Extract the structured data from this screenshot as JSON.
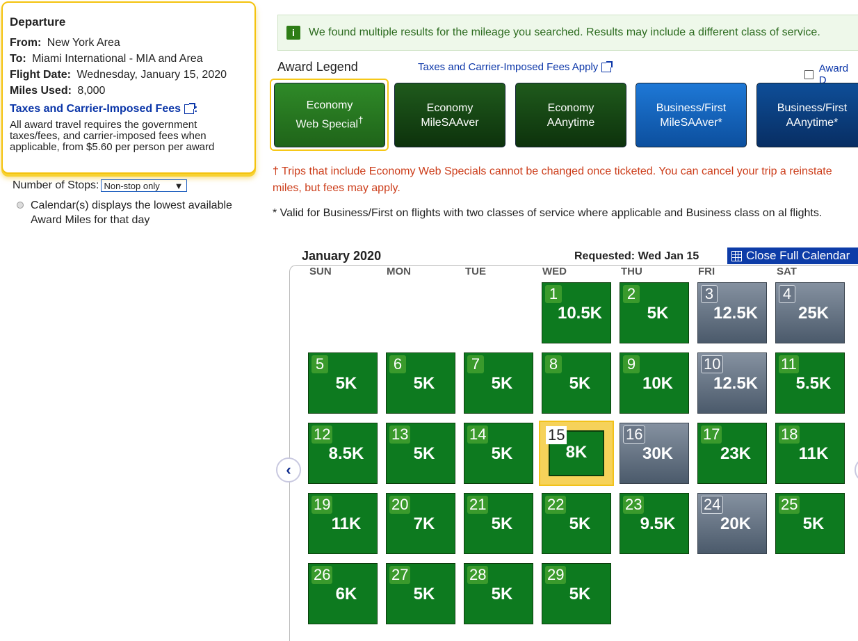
{
  "departure": {
    "title": "Departure",
    "from_label": "From:",
    "from_value": "New York Area",
    "to_label": "To:",
    "to_value": "Miami International - MIA and Area",
    "date_label": "Flight Date:",
    "date_value": "Wednesday, January 15, 2020",
    "miles_label": "Miles Used:",
    "miles_value": "8,000",
    "fees_link": "Taxes and Carrier-Imposed Fees",
    "fees_colon": ":",
    "fees_note": "All award travel requires the government taxes/fees, and carrier-imposed fees when applicable, from $5.60 per person per award"
  },
  "stops": {
    "label": "Number of Stops:",
    "selected": "Non-stop only",
    "arrow": "▼"
  },
  "calendar_note": "Calendar(s) displays the lowest available Award Miles for that day",
  "banner": {
    "icon": "i",
    "text": "We found multiple results for the mileage you searched. Results may include a different class of service."
  },
  "legend": {
    "title": "Award Legend",
    "fees_link": "Taxes and Carrier-Imposed Fees Apply",
    "award_link": "Award D",
    "tiles": [
      {
        "line1": "Economy",
        "line2": "Web Special",
        "sup": "†"
      },
      {
        "line1": "Economy",
        "line2": "MileSAAver",
        "sup": ""
      },
      {
        "line1": "Economy",
        "line2": "AAnytime",
        "sup": ""
      },
      {
        "line1": "Business/First",
        "line2": "MileSAAver*",
        "sup": ""
      },
      {
        "line1": "Business/First",
        "line2": "AAnytime*",
        "sup": ""
      }
    ]
  },
  "notes": {
    "dagger": "† Trips that include Economy Web Specials cannot be changed once ticketed. You can cancel your trip a reinstate miles, but fees may apply.",
    "star": "* Valid for Business/First on flights with two classes of service where applicable and Business class on al flights."
  },
  "calendar": {
    "month": "January 2020",
    "requested": "Requested: Wed Jan 15",
    "close_button": "Close Full Calendar",
    "weekdays": [
      "SUN",
      "MON",
      "TUE",
      "WED",
      "THU",
      "FRI",
      "SAT"
    ],
    "prev_label": "‹",
    "days": [
      {
        "day": "1",
        "miles": "10.5K",
        "type": "green"
      },
      {
        "day": "2",
        "miles": "5K",
        "type": "green"
      },
      {
        "day": "3",
        "miles": "12.5K",
        "type": "gray"
      },
      {
        "day": "4",
        "miles": "25K",
        "type": "gray"
      },
      {
        "day": "5",
        "miles": "5K",
        "type": "green"
      },
      {
        "day": "6",
        "miles": "5K",
        "type": "green"
      },
      {
        "day": "7",
        "miles": "5K",
        "type": "green"
      },
      {
        "day": "8",
        "miles": "5K",
        "type": "green"
      },
      {
        "day": "9",
        "miles": "10K",
        "type": "green"
      },
      {
        "day": "10",
        "miles": "12.5K",
        "type": "gray"
      },
      {
        "day": "11",
        "miles": "5.5K",
        "type": "green"
      },
      {
        "day": "12",
        "miles": "8.5K",
        "type": "green"
      },
      {
        "day": "13",
        "miles": "5K",
        "type": "green"
      },
      {
        "day": "14",
        "miles": "5K",
        "type": "green"
      },
      {
        "day": "15",
        "miles": "8K",
        "type": "selected"
      },
      {
        "day": "16",
        "miles": "30K",
        "type": "gray"
      },
      {
        "day": "17",
        "miles": "23K",
        "type": "green"
      },
      {
        "day": "18",
        "miles": "11K",
        "type": "green"
      },
      {
        "day": "19",
        "miles": "11K",
        "type": "green"
      },
      {
        "day": "20",
        "miles": "7K",
        "type": "green"
      },
      {
        "day": "21",
        "miles": "5K",
        "type": "green"
      },
      {
        "day": "22",
        "miles": "5K",
        "type": "green"
      },
      {
        "day": "23",
        "miles": "9.5K",
        "type": "green"
      },
      {
        "day": "24",
        "miles": "20K",
        "type": "gray"
      },
      {
        "day": "25",
        "miles": "5K",
        "type": "green"
      },
      {
        "day": "26",
        "miles": "6K",
        "type": "green"
      },
      {
        "day": "27",
        "miles": "5K",
        "type": "green"
      },
      {
        "day": "28",
        "miles": "5K",
        "type": "green"
      },
      {
        "day": "29",
        "miles": "5K",
        "type": "green"
      }
    ]
  }
}
